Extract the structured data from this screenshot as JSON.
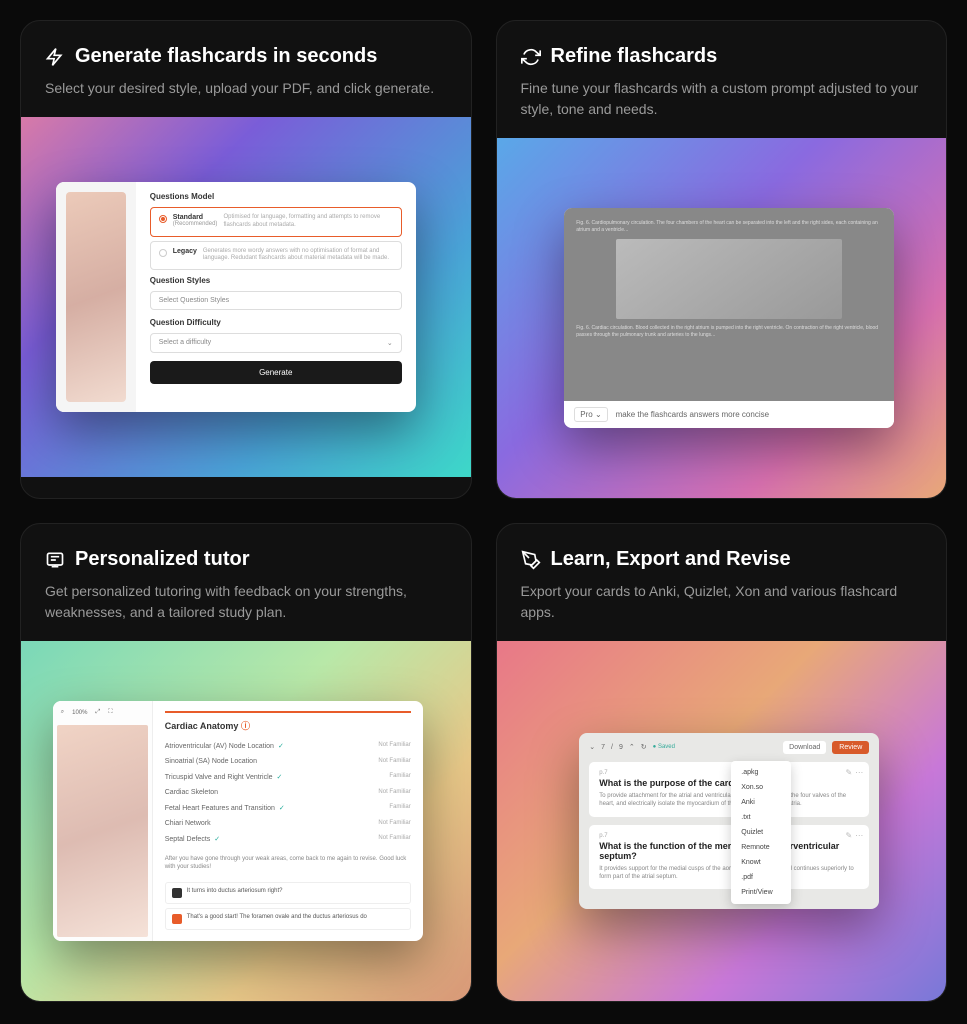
{
  "cards": [
    {
      "icon": "lightning",
      "title": "Generate flashcards in seconds",
      "desc": "Select your desired style, upload your PDF, and click generate."
    },
    {
      "icon": "refresh",
      "title": "Refine flashcards",
      "desc": "Fine tune your flashcards with a custom prompt adjusted to your style, tone and needs."
    },
    {
      "icon": "tutor",
      "title": "Personalized tutor",
      "desc": "Get personalized tutoring with feedback on your strengths, weaknesses, and a tailored study plan."
    },
    {
      "icon": "pen",
      "title": "Learn, Export and Revise",
      "desc": "Export your cards to Anki, Quizlet, Xon and various flashcard apps."
    }
  ],
  "mockup1": {
    "model_label": "Questions Model",
    "standard": {
      "name": "Standard",
      "sub": "(Recommended)",
      "desc": "Optimised for language, formatting and attempts to remove flashcards about metadata."
    },
    "legacy": {
      "name": "Legacy",
      "desc": "Generates more wordy answers with no optimisation of format and language. Redudant flashcards about material metadata will be made."
    },
    "styles_label": "Question Styles",
    "styles_placeholder": "Select Question Styles",
    "difficulty_label": "Question Difficulty",
    "difficulty_placeholder": "Select a difficulty",
    "generate": "Generate"
  },
  "mockup2": {
    "pro": "Pro",
    "prompt": "make the flashcards answers more concise"
  },
  "mockup3": {
    "zoom": "100%",
    "title": "Cardiac Anatomy",
    "rows": [
      {
        "name": "Atrioventricular (AV) Node Location",
        "check": true,
        "status": "Not Familiar"
      },
      {
        "name": "Sinoatrial (SA) Node Location",
        "check": false,
        "status": "Not Familiar"
      },
      {
        "name": "Tricuspid Valve and Right Ventricle",
        "check": true,
        "status": "Familiar"
      },
      {
        "name": "Cardiac Skeleton",
        "check": false,
        "status": "Not Familiar"
      },
      {
        "name": "Fetal Heart Features and Transition",
        "check": true,
        "status": "Familiar"
      },
      {
        "name": "Chiari Network",
        "check": false,
        "status": "Not Familiar"
      },
      {
        "name": "Septal Defects",
        "check": true,
        "status": "Not Familiar"
      }
    ],
    "note": "After you have gone through your weak areas, come back to me again to revise. Good luck with your studies!",
    "chat1": "It turns into ductus arteriosum right?",
    "chat2": "That's a good start! The foramen ovale and the ductus arteriosus do"
  },
  "mockup4": {
    "page_current": "7",
    "page_total": "9",
    "saved": "Saved",
    "download": "Download",
    "review": "Review",
    "dropdown": [
      ".apkg",
      "Xon.so",
      "Anki",
      ".txt",
      "Quizlet",
      "Remnote",
      "Knowt",
      ".pdf",
      "Print/View"
    ],
    "q1": {
      "page": "p.7",
      "title": "What is the purpose of the cardiac skeleton?",
      "body": "To provide attachment for the atrial and ventricular myocardium, anchor the four valves of the heart, and electrically isolate the myocardium of the ventricles from the atria."
    },
    "q2": {
      "page": "p.7",
      "title": "What is the function of the membranous interventricular septum?",
      "body": "It provides support for the medial cusps of the aortic semilunar valve and continues superiorly to form part of the atrial septum."
    }
  }
}
